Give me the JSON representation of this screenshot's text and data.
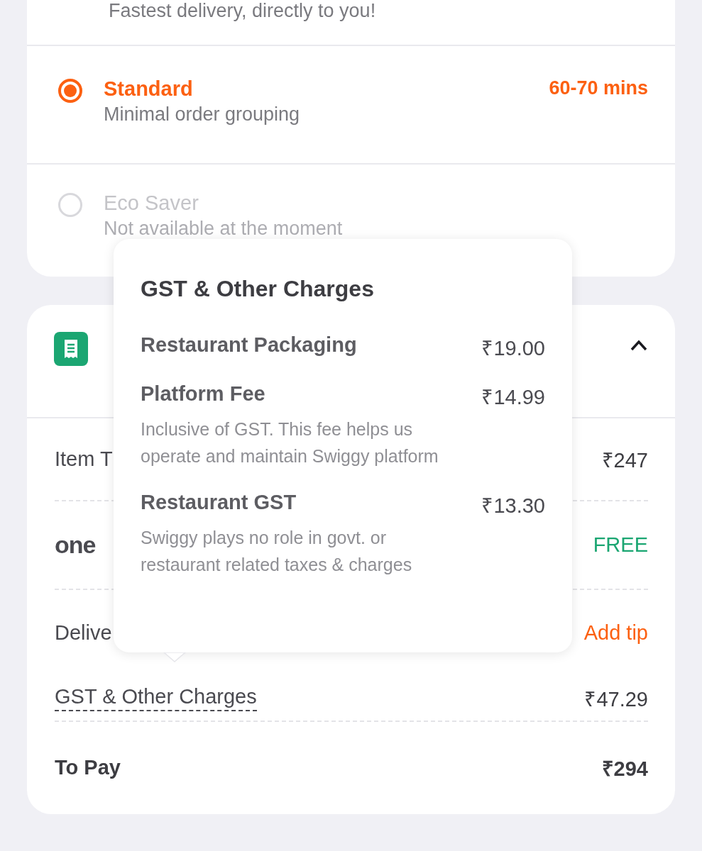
{
  "delivery": {
    "top_note": "Fastest delivery, directly to you!",
    "options": [
      {
        "title": "Standard",
        "subtitle": "Minimal order grouping",
        "time": "60-70 mins",
        "selected": true,
        "disabled": false
      },
      {
        "title": "Eco Saver",
        "subtitle": "Not available at the moment",
        "selected": false,
        "disabled": true
      }
    ]
  },
  "bill": {
    "expanded": true,
    "rows": [
      {
        "kind": "plain",
        "label": "Item T",
        "value": "₹247",
        "divider": true
      },
      {
        "kind": "logo",
        "label": "one",
        "value": "FREE",
        "divider": true
      },
      {
        "kind": "link",
        "label": "Delive",
        "value": "Add tip",
        "divider": false
      },
      {
        "kind": "dotted",
        "label": "GST & Other Charges",
        "value": "₹47.29",
        "divider": true
      }
    ],
    "total": {
      "label": "To Pay",
      "value": "₹294"
    }
  },
  "popover": {
    "title": "GST & Other Charges",
    "items": [
      {
        "name": "Restaurant Packaging",
        "amount": "₹19.00"
      },
      {
        "name": "Platform Fee",
        "amount": "₹14.99",
        "note": "Inclusive of GST. This fee helps us operate and maintain Swiggy platform"
      },
      {
        "name": "Restaurant GST",
        "amount": "₹13.30",
        "note": "Swiggy plays no role in govt. or restaurant related taxes & charges"
      }
    ]
  }
}
